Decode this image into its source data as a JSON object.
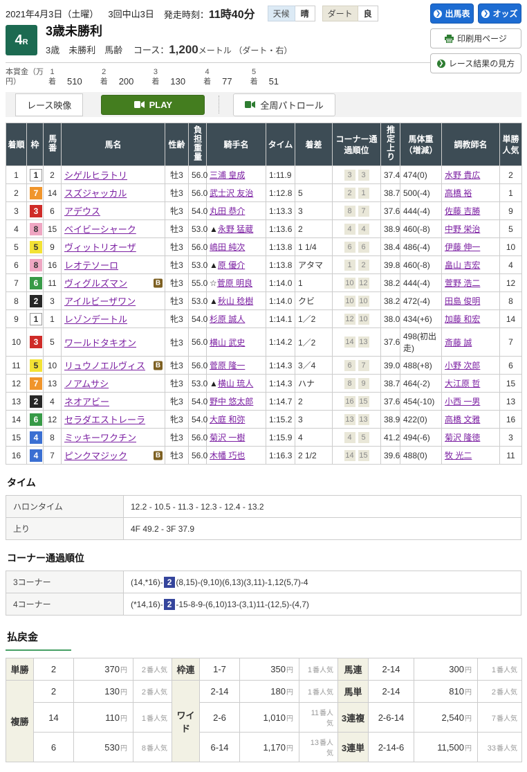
{
  "header": {
    "date_line": "2021年4月3日（土曜）",
    "meeting": "3回中山3日",
    "start_label": "発走時刻：",
    "start_time": "11時40分",
    "weather_label": "天候",
    "weather_value": "晴",
    "track_label": "ダート",
    "track_value": "良",
    "buttons": {
      "entries": "出馬表",
      "odds": "オッズ",
      "print": "印刷用ページ",
      "guide": "レース結果の見方"
    }
  },
  "icons": {
    "arrow": "❯"
  },
  "race": {
    "number": "4",
    "number_suffix": "R",
    "title": "3歳未勝利",
    "conditions": "3歳　未勝利　馬齢",
    "course_label": "コース：",
    "distance": "1,200",
    "distance_unit": "メートル",
    "course_detail": "（ダート・右）"
  },
  "prizes": {
    "label_line1": "本賞金（万",
    "label_line2": "円）",
    "rank_suffix": "着",
    "items": [
      {
        "rank": "1",
        "amount": "510"
      },
      {
        "rank": "2",
        "amount": "200"
      },
      {
        "rank": "3",
        "amount": "130"
      },
      {
        "rank": "4",
        "amount": "77"
      },
      {
        "rank": "5",
        "amount": "51"
      }
    ]
  },
  "video_bar": {
    "label": "レース映像",
    "play": "PLAY",
    "patrol": "全周パトロール"
  },
  "results": {
    "columns": [
      "着順",
      "枠",
      "馬番",
      "馬名",
      "性齢",
      "負担重量",
      "騎手名",
      "タイム",
      "着差",
      "コーナー通過順位",
      "推定上り",
      "馬体重（増減）",
      "調教師名",
      "単勝人気"
    ],
    "rows": [
      {
        "pos": "1",
        "frame": 1,
        "num": "2",
        "horse": "シゲルヒラトリ",
        "blinker": false,
        "sex": "牡3",
        "weight": "56.0",
        "mark": "",
        "jockey": "三浦 皇成",
        "time": "1:11.9",
        "margin": "",
        "corners": [
          "3",
          "3"
        ],
        "last3f": "37.4",
        "hweight": "474(0)",
        "trainer": "水野 貴広",
        "pop": "2"
      },
      {
        "pos": "2",
        "frame": 7,
        "num": "14",
        "horse": "スズジャッカル",
        "blinker": false,
        "sex": "牡3",
        "weight": "56.0",
        "mark": "",
        "jockey": "武士沢 友治",
        "time": "1:12.8",
        "margin": "5",
        "corners": [
          "2",
          "1"
        ],
        "last3f": "38.7",
        "hweight": "500(-4)",
        "trainer": "高橋 裕",
        "pop": "1"
      },
      {
        "pos": "3",
        "frame": 3,
        "num": "6",
        "horse": "アデウス",
        "blinker": false,
        "sex": "牝3",
        "weight": "54.0",
        "mark": "",
        "jockey": "丸田 恭介",
        "time": "1:13.3",
        "margin": "3",
        "corners": [
          "8",
          "7"
        ],
        "last3f": "37.6",
        "hweight": "444(-4)",
        "trainer": "佐藤 吉勝",
        "pop": "9"
      },
      {
        "pos": "4",
        "frame": 8,
        "num": "15",
        "horse": "ベイビーシャーク",
        "blinker": false,
        "sex": "牡3",
        "weight": "53.0",
        "mark": "▲",
        "jockey": "永野 猛蔵",
        "time": "1:13.6",
        "margin": "2",
        "corners": [
          "4",
          "4"
        ],
        "last3f": "38.9",
        "hweight": "460(-8)",
        "trainer": "中野 栄治",
        "pop": "5"
      },
      {
        "pos": "5",
        "frame": 5,
        "num": "9",
        "horse": "ヴィットリオーザ",
        "blinker": false,
        "sex": "牡3",
        "weight": "56.0",
        "mark": "",
        "jockey": "嶋田 純次",
        "time": "1:13.8",
        "margin": "1 1/4",
        "corners": [
          "6",
          "6"
        ],
        "last3f": "38.4",
        "hweight": "486(-4)",
        "trainer": "伊藤 伸一",
        "pop": "10"
      },
      {
        "pos": "6",
        "frame": 8,
        "num": "16",
        "horse": "レオテソーロ",
        "blinker": false,
        "sex": "牡3",
        "weight": "53.0",
        "mark": "▲",
        "jockey": "原 優介",
        "time": "1:13.8",
        "margin": "アタマ",
        "corners": [
          "1",
          "2"
        ],
        "last3f": "39.8",
        "hweight": "460(-8)",
        "trainer": "畠山 吉宏",
        "pop": "4"
      },
      {
        "pos": "7",
        "frame": 6,
        "num": "11",
        "horse": "ヴィグルズマン",
        "blinker": true,
        "sex": "牡3",
        "weight": "55.0",
        "mark": "☆",
        "jockey": "菅原 明良",
        "time": "1:14.0",
        "margin": "1",
        "corners": [
          "10",
          "12"
        ],
        "last3f": "38.2",
        "hweight": "444(-4)",
        "trainer": "萱野 浩二",
        "pop": "12"
      },
      {
        "pos": "8",
        "frame": 2,
        "num": "3",
        "horse": "アイルビーザワン",
        "blinker": false,
        "sex": "牡3",
        "weight": "53.0",
        "mark": "▲",
        "jockey": "秋山 稔樹",
        "time": "1:14.0",
        "margin": "クビ",
        "corners": [
          "10",
          "10"
        ],
        "last3f": "38.2",
        "hweight": "472(-4)",
        "trainer": "田島 俊明",
        "pop": "8"
      },
      {
        "pos": "9",
        "frame": 1,
        "num": "1",
        "horse": "レゾンデートル",
        "blinker": false,
        "sex": "牝3",
        "weight": "54.0",
        "mark": "",
        "jockey": "杉原 誠人",
        "time": "1:14.1",
        "margin": "1／2",
        "corners": [
          "12",
          "10"
        ],
        "last3f": "38.0",
        "hweight": "434(+6)",
        "trainer": "加藤 和宏",
        "pop": "14"
      },
      {
        "pos": "10",
        "frame": 3,
        "num": "5",
        "horse": "ワールドタキオン",
        "blinker": false,
        "sex": "牡3",
        "weight": "56.0",
        "mark": "",
        "jockey": "横山 武史",
        "time": "1:14.2",
        "margin": "1／2",
        "corners": [
          "14",
          "13"
        ],
        "last3f": "37.6",
        "hweight": "498(初出走)",
        "trainer": "斎藤 誠",
        "pop": "7"
      },
      {
        "pos": "11",
        "frame": 5,
        "num": "10",
        "horse": "リュウノエルヴィス",
        "blinker": true,
        "sex": "牡3",
        "weight": "56.0",
        "mark": "",
        "jockey": "菅原 隆一",
        "time": "1:14.3",
        "margin": "3／4",
        "corners": [
          "6",
          "7"
        ],
        "last3f": "39.0",
        "hweight": "488(+8)",
        "trainer": "小野 次郎",
        "pop": "6"
      },
      {
        "pos": "12",
        "frame": 7,
        "num": "13",
        "horse": "ノアムサシ",
        "blinker": false,
        "sex": "牡3",
        "weight": "53.0",
        "mark": "▲",
        "jockey": "横山 琉人",
        "time": "1:14.3",
        "margin": "ハナ",
        "corners": [
          "8",
          "9"
        ],
        "last3f": "38.7",
        "hweight": "464(-2)",
        "trainer": "大江原 哲",
        "pop": "15"
      },
      {
        "pos": "13",
        "frame": 2,
        "num": "4",
        "horse": "ネオアビー",
        "blinker": false,
        "sex": "牝3",
        "weight": "54.0",
        "mark": "",
        "jockey": "野中 悠太郎",
        "time": "1:14.7",
        "margin": "2",
        "corners": [
          "16",
          "15"
        ],
        "last3f": "37.6",
        "hweight": "454(-10)",
        "trainer": "小西 一男",
        "pop": "13"
      },
      {
        "pos": "14",
        "frame": 6,
        "num": "12",
        "horse": "セラダエストレーラ",
        "blinker": false,
        "sex": "牝3",
        "weight": "54.0",
        "mark": "",
        "jockey": "大庭 和弥",
        "time": "1:15.2",
        "margin": "3",
        "corners": [
          "13",
          "13"
        ],
        "last3f": "38.9",
        "hweight": "422(0)",
        "trainer": "高橋 文雅",
        "pop": "16"
      },
      {
        "pos": "15",
        "frame": 4,
        "num": "8",
        "horse": "ミッキーワクチン",
        "blinker": false,
        "sex": "牡3",
        "weight": "56.0",
        "mark": "",
        "jockey": "菊沢 一樹",
        "time": "1:15.9",
        "margin": "4",
        "corners": [
          "4",
          "5"
        ],
        "last3f": "41.2",
        "hweight": "494(-6)",
        "trainer": "菊沢 隆徳",
        "pop": "3"
      },
      {
        "pos": "16",
        "frame": 4,
        "num": "7",
        "horse": "ピンクマジック",
        "blinker": true,
        "sex": "牡3",
        "weight": "56.0",
        "mark": "",
        "jockey": "木幡 巧也",
        "time": "1:16.3",
        "margin": "2 1/2",
        "corners": [
          "14",
          "15"
        ],
        "last3f": "39.6",
        "hweight": "488(0)",
        "trainer": "牧 光二",
        "pop": "11"
      }
    ]
  },
  "time_section": {
    "title": "タイム",
    "furlong_label": "ハロンタイム",
    "furlong_value": "12.2 - 10.5 - 11.3 - 12.3 - 12.4 - 13.2",
    "agari_label": "上り",
    "agari_value": "4F 49.2 - 3F 37.9"
  },
  "corner_section": {
    "title": "コーナー通過順位",
    "rows": [
      {
        "label": "3コーナー",
        "pre": "(14,*16)-",
        "highlight": "2",
        "post": "(8,15)-(9,10)(6,13)(3,11)-1,12(5,7)-4"
      },
      {
        "label": "4コーナー",
        "pre": "(*14,16)-",
        "highlight": "2",
        "post": "-15-8-9-(6,10)13-(3,1)11-(12,5)-(4,7)"
      }
    ]
  },
  "payouts": {
    "title": "払戻金",
    "yen": "円",
    "pop_suffix": "番人気",
    "types": {
      "win": "単勝",
      "place": "複勝",
      "bracket": "枠連",
      "wide": "ワイド",
      "quinella": "馬連",
      "exacta": "馬単",
      "trio": "3連複",
      "trifecta": "3連単"
    },
    "win": {
      "combo": "2",
      "amount": "370",
      "pop": "2"
    },
    "place": [
      {
        "combo": "2",
        "amount": "130",
        "pop": "2"
      },
      {
        "combo": "14",
        "amount": "110",
        "pop": "1"
      },
      {
        "combo": "6",
        "amount": "530",
        "pop": "8"
      }
    ],
    "bracket": {
      "combo": "1-7",
      "amount": "350",
      "pop": "1"
    },
    "wide": [
      {
        "combo": "2-14",
        "amount": "180",
        "pop": "1"
      },
      {
        "combo": "2-6",
        "amount": "1,010",
        "pop": "11"
      },
      {
        "combo": "6-14",
        "amount": "1,170",
        "pop": "13"
      }
    ],
    "quinella": {
      "combo": "2-14",
      "amount": "300",
      "pop": "1"
    },
    "exacta": {
      "combo": "2-14",
      "amount": "810",
      "pop": "2"
    },
    "trio": {
      "combo": "2-6-14",
      "amount": "2,540",
      "pop": "7"
    },
    "trifecta": {
      "combo": "2-14-6",
      "amount": "11,500",
      "pop": "33"
    }
  }
}
